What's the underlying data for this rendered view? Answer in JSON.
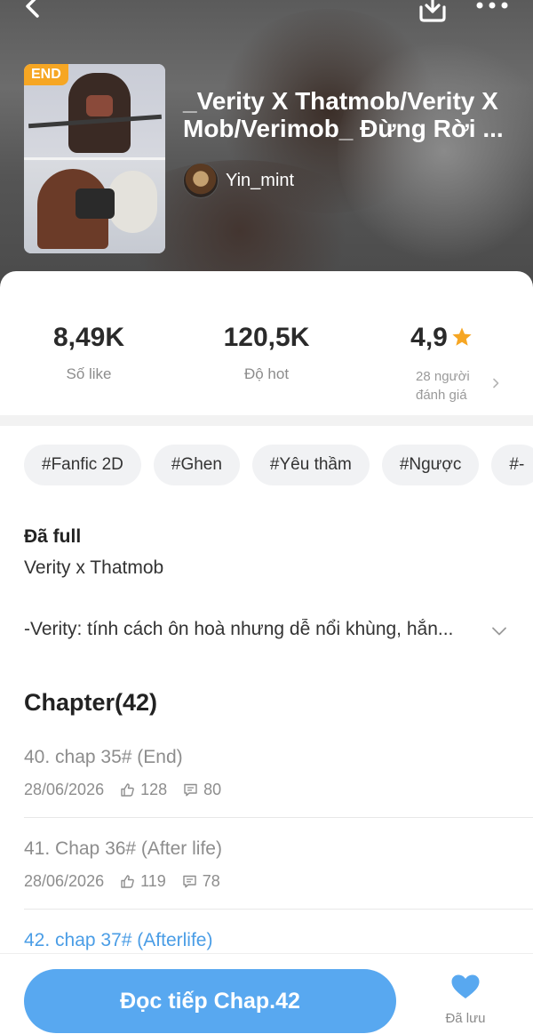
{
  "header": {
    "badge": "END",
    "title": "_Verity X Thatmob/Verity X\nMob/Verimob_ Đừng Rời ...",
    "author": "Yin_mint"
  },
  "icons": {
    "back": "chevron-left-icon",
    "download": "download-icon",
    "more": "more-dots-icon"
  },
  "stats": {
    "likes_value": "8,49K",
    "likes_label": "Số like",
    "hot_value": "120,5K",
    "hot_label": "Độ hot",
    "rating_value": "4,9",
    "rating_label_line1": "28 người",
    "rating_label_line2": "đánh giá",
    "star_color": "#f6a623"
  },
  "tags": [
    "#Fanfic 2D",
    "#Ghen",
    "#Yêu thầm",
    "#Ngược",
    "#-"
  ],
  "story": {
    "status": "Đã full",
    "subtitle": "Verity x Thatmob",
    "description": "-Verity: tính cách ôn hoà nhưng dễ nổi khùng, hắn..."
  },
  "chapters": {
    "heading": "Chapter(42)",
    "items": [
      {
        "title": "40. chap 35# (End)",
        "date": "28/06/2026",
        "likes": "128",
        "comments": "80"
      },
      {
        "title": "41. Chap 36# (After life)",
        "date": "28/06/2026",
        "likes": "119",
        "comments": "78"
      },
      {
        "title": "42. chap 37# (Afterlife)",
        "date": "",
        "likes": "",
        "comments": ""
      }
    ]
  },
  "bottom": {
    "read_button": "Đọc tiếp Chap.42",
    "saved_label": "Đã lưu",
    "accent_color": "#58a8f0"
  }
}
